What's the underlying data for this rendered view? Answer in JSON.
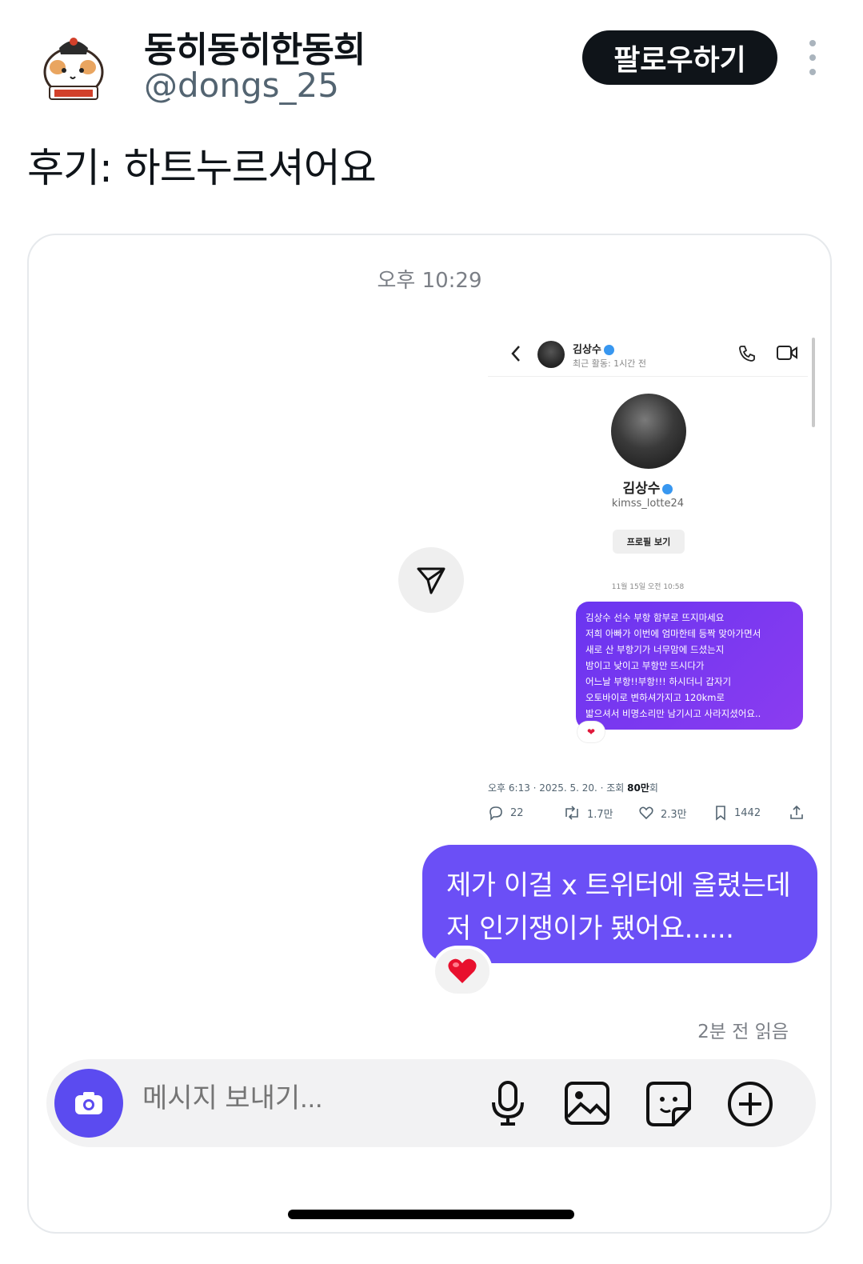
{
  "tweet": {
    "display_name": "동히동히한동희",
    "handle": "@dongs_25",
    "follow_label": "팔로우하기",
    "text": "후기: 하트누르셔어요"
  },
  "chat": {
    "timestamp": "오후 10:29",
    "main_message_line1": "제가 이걸 x 트위터에 올렸는데",
    "main_message_line2": "저 인기쟁이가 됐어요......",
    "reaction": "❤️",
    "read_status": "2분 전 읽음",
    "composer_placeholder": "메시지 보내기...",
    "accent_color": "#6b4ff6"
  },
  "inner": {
    "name": "김상수",
    "last_active": "최근 활동: 1시간 전",
    "handle": "kimss_lotte24",
    "profile_button": "프로필 보기",
    "date": "11월 15일 오전 10:58",
    "message_lines": [
      "김상수 선수 부항 함부로 뜨지마세요",
      "저희 아빠가 이번에 엄마한테 등짝 맞아가면서",
      "새로 산 부항기가 너무맘에 드셨는지",
      "밤이고 낮이고 부항만 뜨시다가",
      "어느날 부항!!부항!!! 하시더니 갑자기",
      "오토바이로 변하셔가지고 120km로",
      "밟으셔서 비명소리만 남기시고 사라지셨어요.."
    ],
    "reaction": "❤",
    "tweet_meta_prefix": "오후 6:13 · 2025. 5. 20. · 조회 ",
    "tweet_views": "80만",
    "tweet_views_suffix": "회",
    "replies": "22",
    "retweets": "1.7만",
    "likes": "2.3만",
    "bookmarks": "1442"
  }
}
